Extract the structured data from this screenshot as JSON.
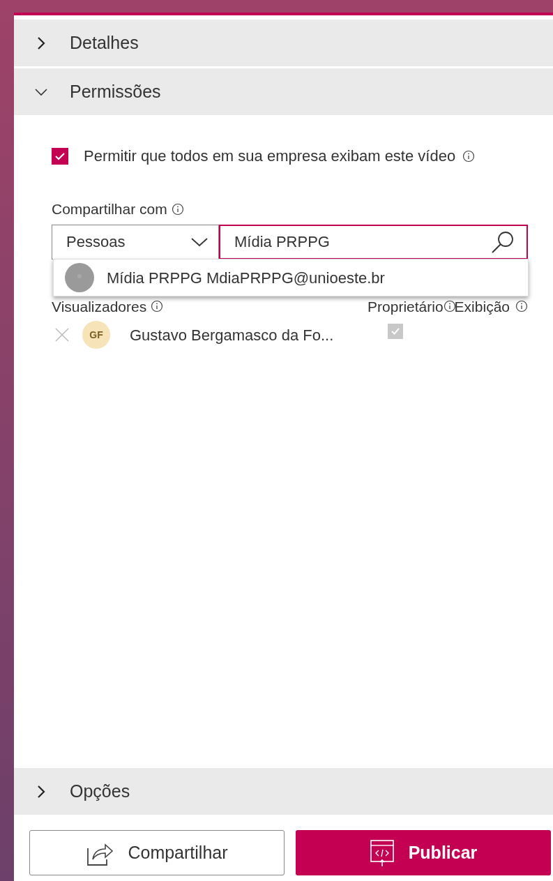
{
  "sections": [
    {
      "title": "Detalhes",
      "expanded": false
    },
    {
      "title": "Permissões",
      "expanded": true
    },
    {
      "title": "Opções",
      "expanded": false
    }
  ],
  "permissions": {
    "allow_company": {
      "label": "Permitir que todos em sua empresa exibam este vídeo",
      "checked": true
    },
    "share_label": "Compartilhar com",
    "share_type": "Pessoas",
    "search": {
      "value": "Mídia PRPPG"
    },
    "suggestions": [
      {
        "text": "Mídia PRPPG MdiaPRPPG@unioeste.br"
      }
    ],
    "columns": [
      "Visualizadores",
      "Proprietário",
      "Exibição"
    ],
    "viewers": [
      {
        "initials": "GF",
        "name": "Gustavo Bergamasco da Fo...",
        "owner": true,
        "owner_disabled": true
      }
    ]
  },
  "buttons": [
    {
      "label": "Compartilhar",
      "kind": "secondary"
    },
    {
      "label": "Publicar",
      "kind": "primary"
    }
  ]
}
